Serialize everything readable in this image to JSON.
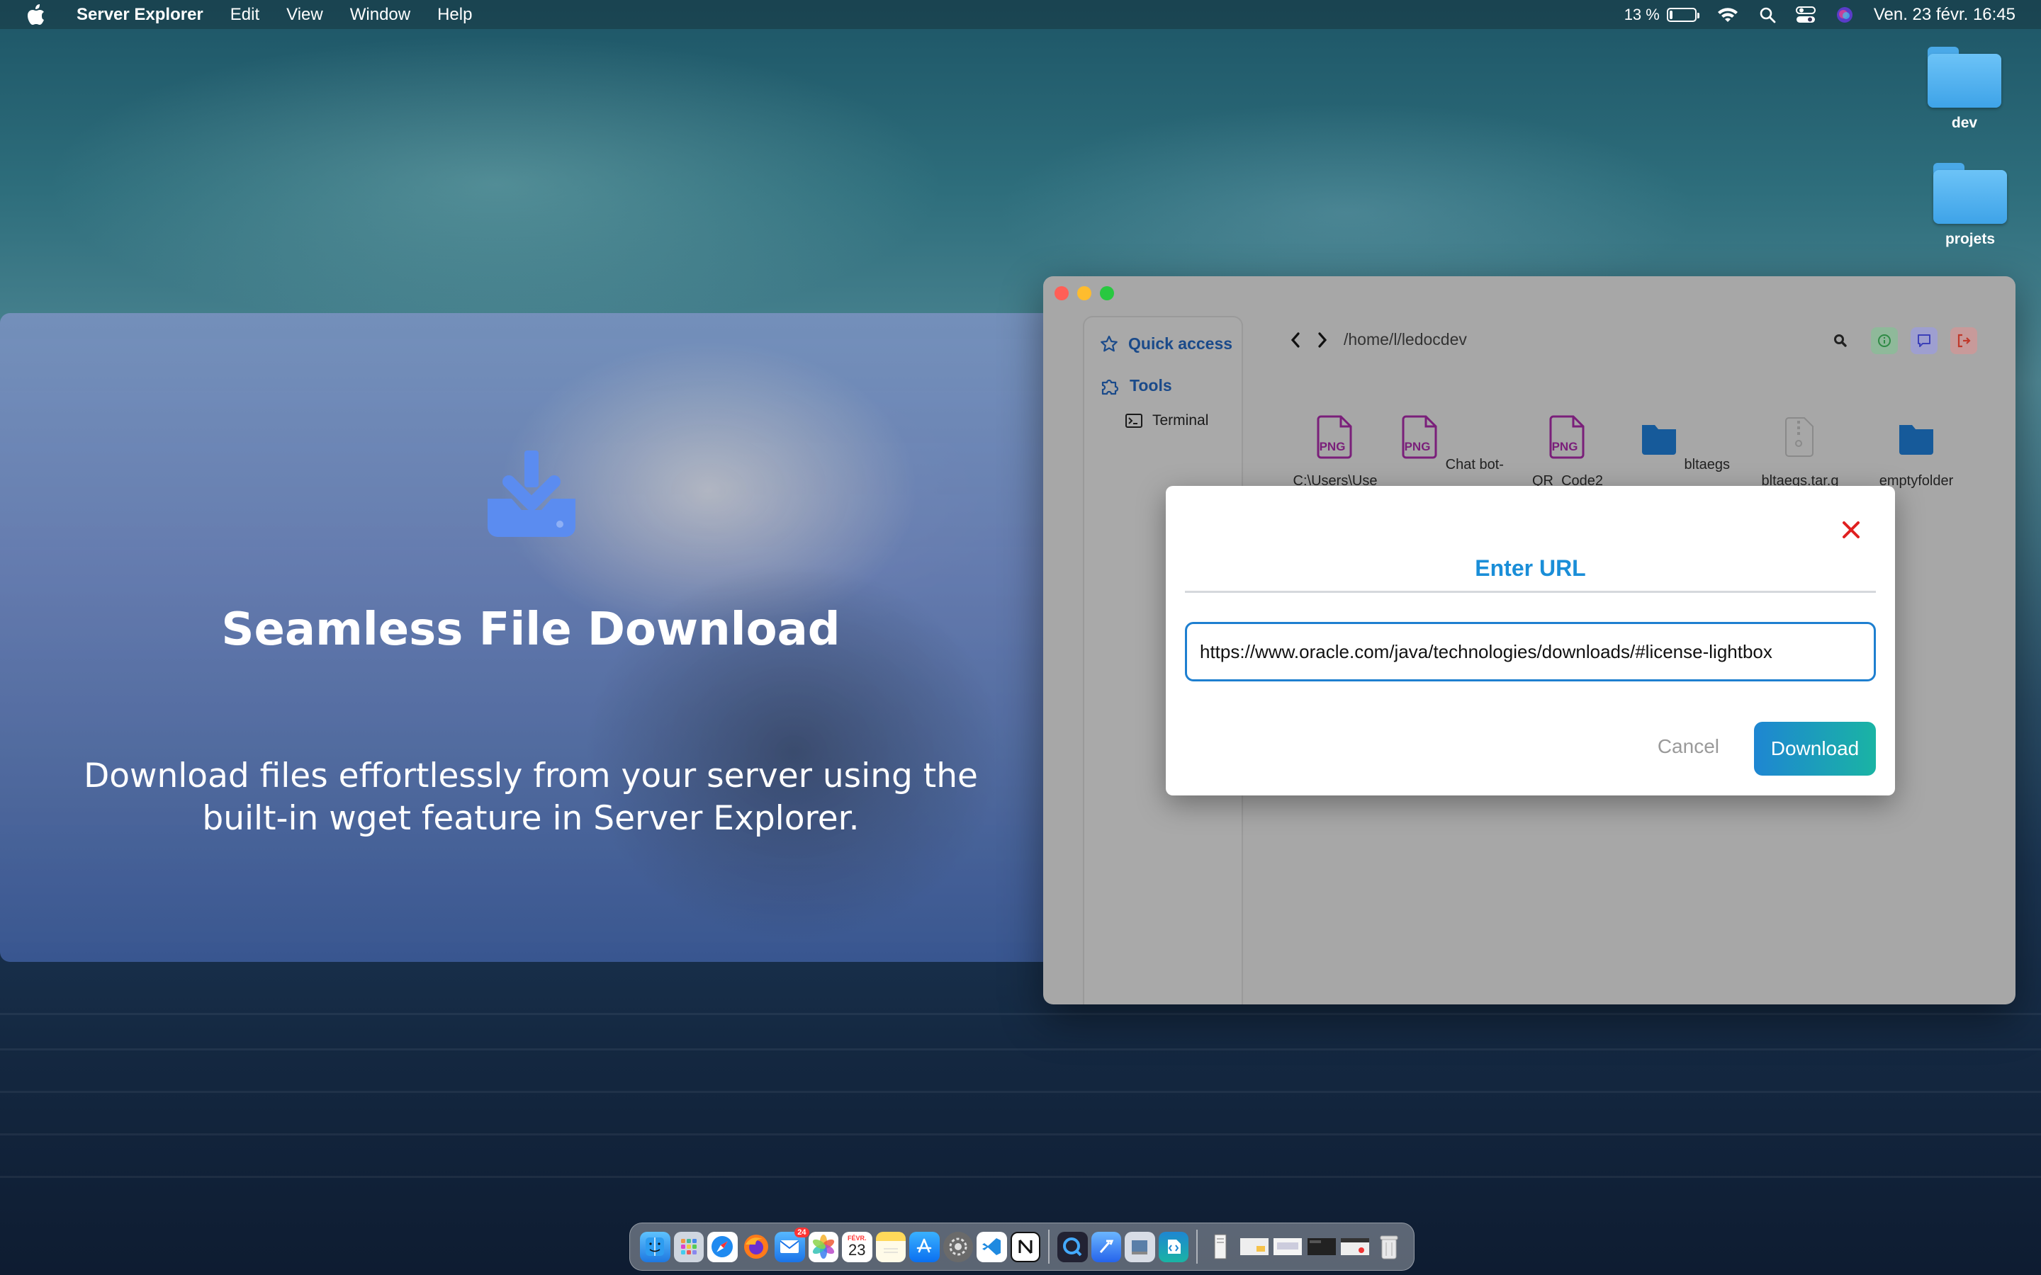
{
  "menubar": {
    "app_name": "Server Explorer",
    "menus": [
      "Edit",
      "View",
      "Window",
      "Help"
    ],
    "battery_percent": "13 %",
    "battery_level": 0.13,
    "datetime": "Ven. 23 févr.  16:45"
  },
  "desktop": {
    "icons": [
      {
        "label": "dev",
        "icon": "folder-icon"
      },
      {
        "label": "projets",
        "icon": "folder-icon"
      }
    ]
  },
  "promo": {
    "title": "Seamless File Download",
    "description": "Download files effortlessly from your server using the built-in wget feature in Server Explorer.",
    "icon": "download-tray-icon",
    "icon_color": "#5b8cf0"
  },
  "window": {
    "sidebar": {
      "quick_access": "Quick access",
      "tools": "Tools",
      "terminal": "Terminal"
    },
    "path": "/home/l/ledocdev",
    "files": [
      {
        "name": "C:\\Users\\Use",
        "type": "png"
      },
      {
        "name": "Chat bot-",
        "type": "png"
      },
      {
        "name": "QR_Code2",
        "type": "png"
      },
      {
        "name": "bltaegs",
        "type": "folder"
      },
      {
        "name": "bltaegs.tar.g",
        "type": "archive"
      },
      {
        "name": "emptyfolder",
        "type": "folder"
      }
    ],
    "file_type_label": "PNG"
  },
  "dialog": {
    "title": "Enter URL",
    "url_value": "https://www.oracle.com/java/technologies/downloads/#license-lightbox",
    "cancel_label": "Cancel",
    "download_label": "Download",
    "accent": "#1a8ed8",
    "close_color": "#e02020"
  },
  "dock": {
    "calendar_day": "23",
    "calendar_month": "FÉVR.",
    "mail_badge": "24",
    "apps": [
      "finder",
      "launchpad",
      "safari",
      "firefox",
      "mail",
      "photos",
      "calendar",
      "notes",
      "app-store",
      "system-settings",
      "vscode",
      "notion",
      "quicktime",
      "xcode",
      "preview",
      "server-explorer",
      "file",
      "window-1",
      "window-2",
      "window-3",
      "window-4",
      "trash"
    ]
  }
}
